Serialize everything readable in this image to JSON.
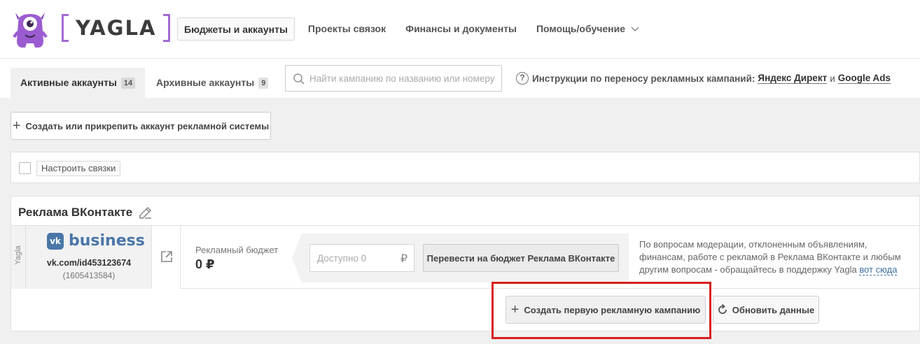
{
  "brand": {
    "name": "YAGLA",
    "accent": "#a36bd4"
  },
  "nav": {
    "items": [
      {
        "label": "Бюджеты и аккаунты",
        "active": true
      },
      {
        "label": "Проекты связок"
      },
      {
        "label": "Финансы и документы"
      },
      {
        "label": "Помощь/обучение",
        "dropdown": true
      }
    ]
  },
  "tabs": [
    {
      "label": "Активные аккаунты",
      "count": "14",
      "active": true
    },
    {
      "label": "Архивные аккаунты",
      "count": "9"
    }
  ],
  "search": {
    "placeholder": "Найти кампанию по названию или номеру",
    "value": ""
  },
  "help": {
    "text": "Инструкции по переносу рекламных кампаний:",
    "link1": "Яндекс Директ",
    "conj": "и",
    "link2": "Google Ads"
  },
  "actions": {
    "create_account": "Создать или прикрепить аккаунт рекламной системы"
  },
  "toolbar": {
    "setup_links": "Настроить связки"
  },
  "account": {
    "title": "Реклама ВКонтакте",
    "side_label": "Yagla",
    "vk_word": "business",
    "url": "vk.com/id453123674",
    "id": "(1605413584)",
    "budget_label": "Рекламный бюджет",
    "budget_value": "0 ₽",
    "available_placeholder": "Доступно 0",
    "currency": "₽",
    "transfer_button": "Перевести на бюджет Реклама ВКонтакте",
    "support_text": "По вопросам модерации, отклоненным объявлениям, финансам, работе с рекламой в Реклама ВКонтакте и любым другим вопросам - обращайтесь в поддержку Yagla",
    "support_link": "вот сюда",
    "create_first": "Создать первую рекламную кампанию",
    "refresh": "Обновить данные"
  },
  "colors": {
    "vk_blue": "#4a76a8",
    "highlight_red": "#d81e1e",
    "link_blue": "#3d6fa3"
  }
}
